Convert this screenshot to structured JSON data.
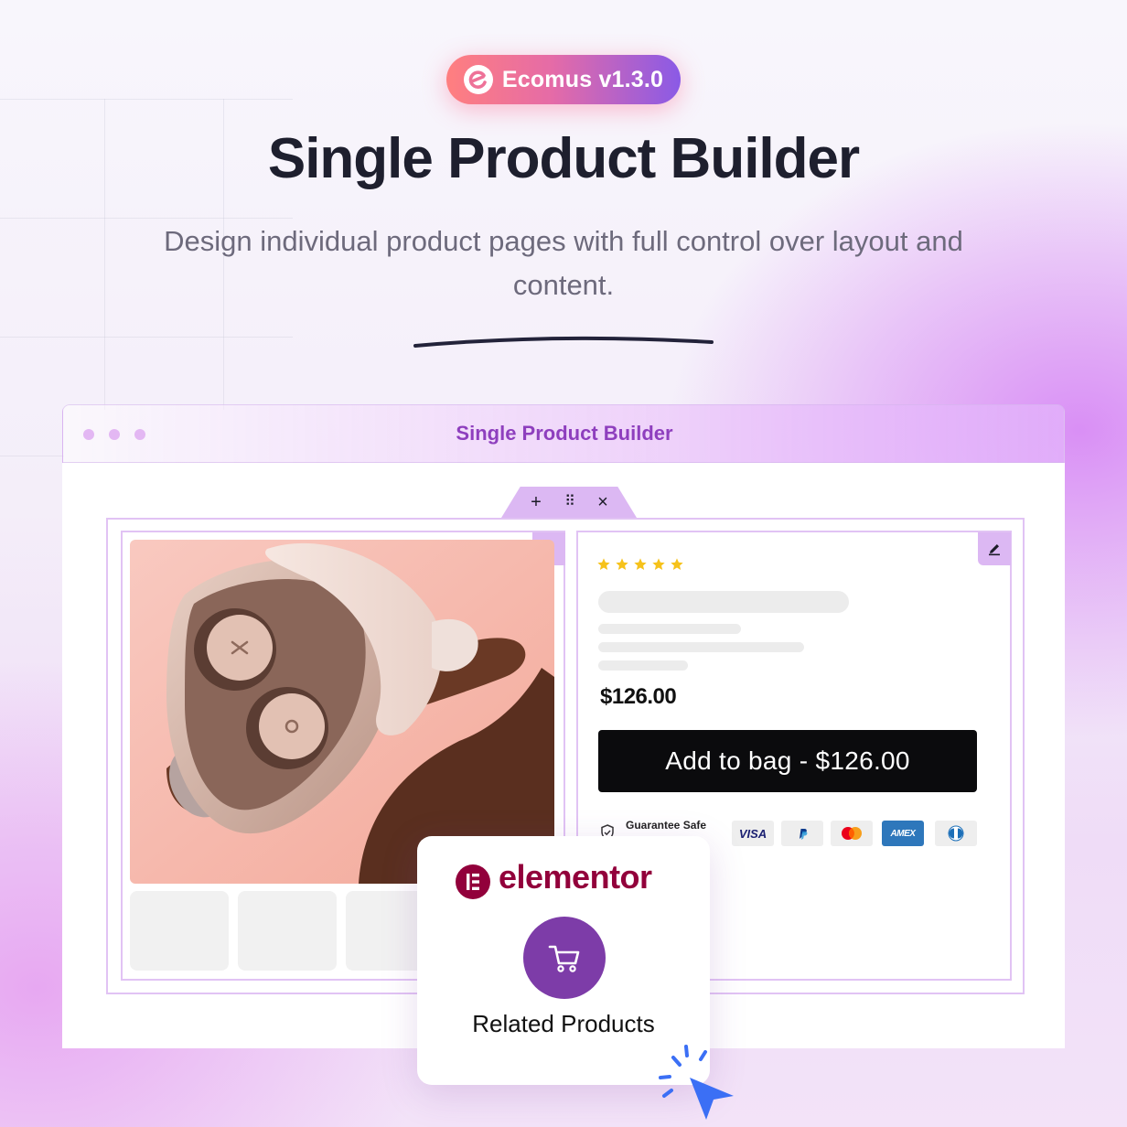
{
  "badge": {
    "text": "Ecomus v1.3.0",
    "icon": "ecomus-logo-icon"
  },
  "hero": {
    "title": "Single Product Builder",
    "subtitle": "Design individual product pages with full control over layout and content."
  },
  "window": {
    "title": "Single Product Builder",
    "toolbar": {
      "add": "+",
      "drag": "⠿",
      "close": "×"
    }
  },
  "product": {
    "rating_stars": 5,
    "price": "$126.00",
    "add_to_bag": "Add to bag - $126.00",
    "guarantee": "Guarantee Safe",
    "payment_methods": [
      "VISA",
      "PayPal",
      "Mastercard",
      "AMEX",
      "Diners Club"
    ]
  },
  "popup": {
    "brand": "elementor",
    "widget_label": "Related Products",
    "widget_icon": "cart-icon"
  },
  "colors": {
    "accent_purple": "#8e3fbe",
    "elementor": "#92003b",
    "button": "#0b0b0d",
    "star": "#f6c21b"
  }
}
